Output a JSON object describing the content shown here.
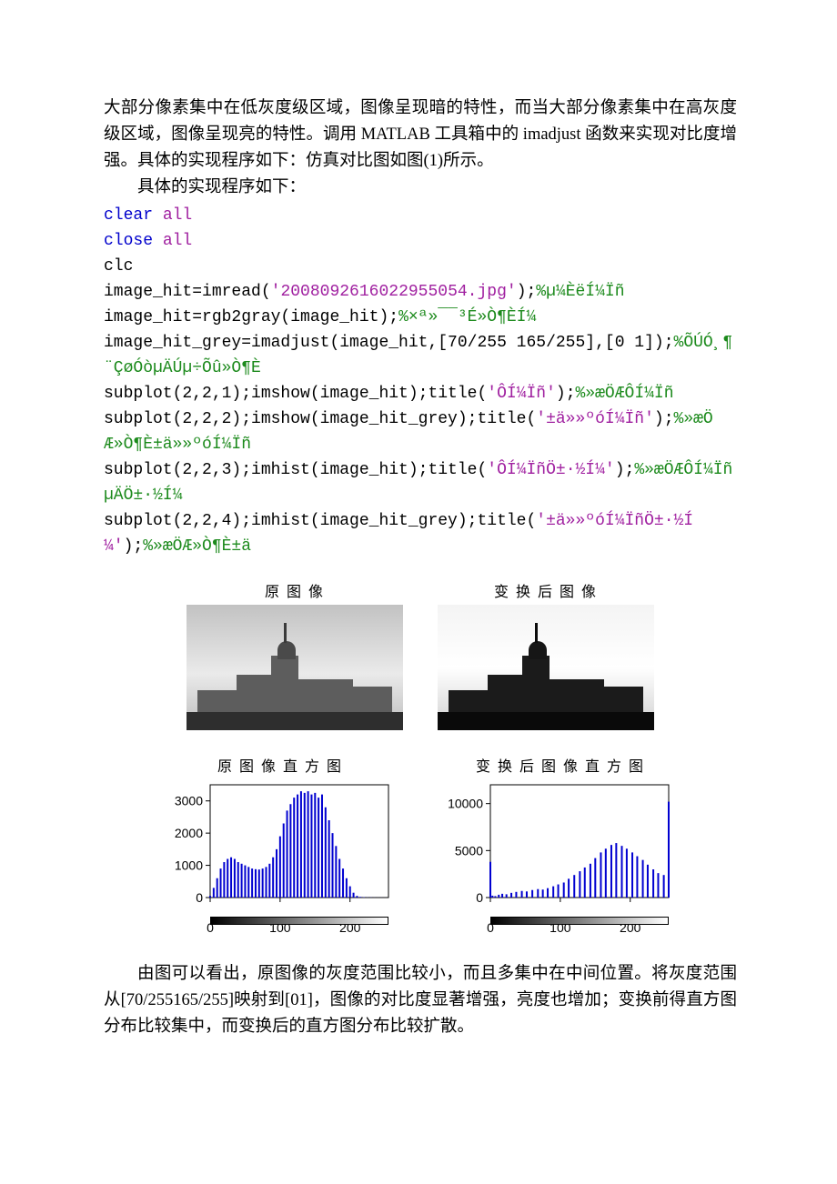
{
  "para1": "大部分像素集中在低灰度级区域，图像呈现暗的特性，而当大部分像素集中在高灰度级区域，图像呈现亮的特性。调用 MATLAB 工具箱中的 imadjust 函数来实现对比度增强。具体的实现程序如下：仿真对比图如图(1)所示。",
  "para2": "具体的实现程序如下：",
  "code": {
    "l1a": "clear ",
    "l1b": "all",
    "l2a": "close ",
    "l2b": "all",
    "l3": "clc",
    "l4a": "image_hit=imread(",
    "l4b": "'2008092616022955054.jpg'",
    "l4c": ");",
    "l4d": "%µ¼ÈëÍ¼Ïñ",
    "l5a": "image_hit=rgb2gray(image_hit);",
    "l5b": "%×ª»¯¯³É»Ò¶ÈÍ¼",
    "l6": "image_hit_grey=imadjust(image_hit,[70/255 165/255],[0 1]);",
    "l6c": "%ÕÚÓ¸¶¨ÇøÓòµÄÚµ÷Õû»Ò¶È",
    "l7a": "subplot(2,2,1);imshow(image_hit);title(",
    "l7b": "'Ô­Í¼Ïñ'",
    "l7c": ");",
    "l7d": "%»æÖÆÔ­Í¼Ïñ",
    "l8a": "subplot(2,2,2);imshow(image_hit_grey);title(",
    "l8b": "'±ä»»ºóÍ¼Ïñ'",
    "l8c": ");",
    "l8d": "%»æÖÆ»Ò¶È±ä»»ºóÍ¼Ïñ",
    "l9a": "subplot(2,2,3);imhist(image_hit);title(",
    "l9b": "'Ô­Í¼ÏñÖ±·½Í¼'",
    "l9c": ");",
    "l9d": "%»æÖÆÔ­Í¼ÏñµÄÖ±·½Í¼",
    "l10a": "subplot(2,2,4);imhist(image_hit_grey);title(",
    "l10b": "'±ä»»ºóÍ¼ÏñÖ±·½Í¼'",
    "l10c": ");",
    "l10d": "%»æÖÆ»Ò¶È±ä"
  },
  "fig": {
    "t1": "原 图 像",
    "t2": "变 换 后 图 像",
    "t3": "原 图 像 直 方 图",
    "t4": "变 换 后 图 像 直 方 图"
  },
  "chart_data": [
    {
      "type": "bar",
      "title": "原图像直方图",
      "xlabel": "",
      "ylabel": "",
      "xlim": [
        0,
        255
      ],
      "ylim": [
        0,
        3500
      ],
      "xticks": [
        0,
        100,
        200
      ],
      "yticks": [
        0,
        1000,
        2000,
        3000
      ],
      "values_desc": "Histogram of original image: concentrated mid-range ~70–165, peak ~3300 around 130–160, secondary hump ~1200 around 20–60, near-zero above ~210.",
      "samples": [
        [
          0,
          50
        ],
        [
          5,
          300
        ],
        [
          10,
          600
        ],
        [
          15,
          900
        ],
        [
          20,
          1100
        ],
        [
          25,
          1200
        ],
        [
          30,
          1250
        ],
        [
          35,
          1200
        ],
        [
          40,
          1100
        ],
        [
          45,
          1050
        ],
        [
          50,
          1000
        ],
        [
          55,
          950
        ],
        [
          60,
          900
        ],
        [
          65,
          880
        ],
        [
          70,
          870
        ],
        [
          75,
          900
        ],
        [
          80,
          950
        ],
        [
          85,
          1050
        ],
        [
          90,
          1250
        ],
        [
          95,
          1500
        ],
        [
          100,
          1900
        ],
        [
          105,
          2300
        ],
        [
          110,
          2700
        ],
        [
          115,
          2900
        ],
        [
          120,
          3100
        ],
        [
          125,
          3200
        ],
        [
          130,
          3300
        ],
        [
          135,
          3250
        ],
        [
          140,
          3300
        ],
        [
          145,
          3200
        ],
        [
          150,
          3250
        ],
        [
          155,
          3100
        ],
        [
          160,
          3200
        ],
        [
          165,
          2800
        ],
        [
          170,
          2400
        ],
        [
          175,
          2000
        ],
        [
          180,
          1600
        ],
        [
          185,
          1200
        ],
        [
          190,
          900
        ],
        [
          195,
          600
        ],
        [
          200,
          350
        ],
        [
          205,
          150
        ],
        [
          210,
          50
        ],
        [
          215,
          20
        ],
        [
          220,
          10
        ],
        [
          225,
          5
        ],
        [
          230,
          5
        ],
        [
          235,
          3
        ],
        [
          240,
          2
        ],
        [
          245,
          2
        ],
        [
          250,
          1
        ],
        [
          255,
          1
        ]
      ]
    },
    {
      "type": "bar",
      "title": "变换后图像直方图",
      "xlabel": "",
      "ylabel": "",
      "xlim": [
        0,
        255
      ],
      "ylim": [
        0,
        12000
      ],
      "xticks": [
        0,
        100,
        200
      ],
      "yticks": [
        0,
        5000,
        10000
      ],
      "values_desc": "Histogram after imadjust [70/255 165/255]→[0 1]: sparse spikes across full range, large spike ~10000 near 255 (clipped highlights), moderate spike near 0, mid spikes ~3000–6000.",
      "samples": [
        [
          0,
          3800
        ],
        [
          3,
          200
        ],
        [
          7,
          150
        ],
        [
          12,
          300
        ],
        [
          17,
          400
        ],
        [
          23,
          350
        ],
        [
          30,
          500
        ],
        [
          37,
          600
        ],
        [
          45,
          700
        ],
        [
          52,
          650
        ],
        [
          60,
          800
        ],
        [
          68,
          900
        ],
        [
          75,
          850
        ],
        [
          82,
          1000
        ],
        [
          90,
          1200
        ],
        [
          97,
          1400
        ],
        [
          105,
          1600
        ],
        [
          112,
          2000
        ],
        [
          120,
          2400
        ],
        [
          128,
          2800
        ],
        [
          135,
          3200
        ],
        [
          143,
          3600
        ],
        [
          150,
          4200
        ],
        [
          158,
          4800
        ],
        [
          165,
          5200
        ],
        [
          173,
          5600
        ],
        [
          180,
          5800
        ],
        [
          188,
          5500
        ],
        [
          195,
          5200
        ],
        [
          203,
          4800
        ],
        [
          210,
          4400
        ],
        [
          218,
          4000
        ],
        [
          225,
          3500
        ],
        [
          233,
          3000
        ],
        [
          240,
          2600
        ],
        [
          248,
          2400
        ],
        [
          255,
          10200
        ]
      ]
    }
  ],
  "conclusion": "由图可以看出，原图像的灰度范围比较小，而且多集中在中间位置。将灰度范围从[70/255165/255]映射到[01]，图像的对比度显著增强，亮度也增加；变换前得直方图分布比较集中，而变换后的直方图分布比较扩散。"
}
